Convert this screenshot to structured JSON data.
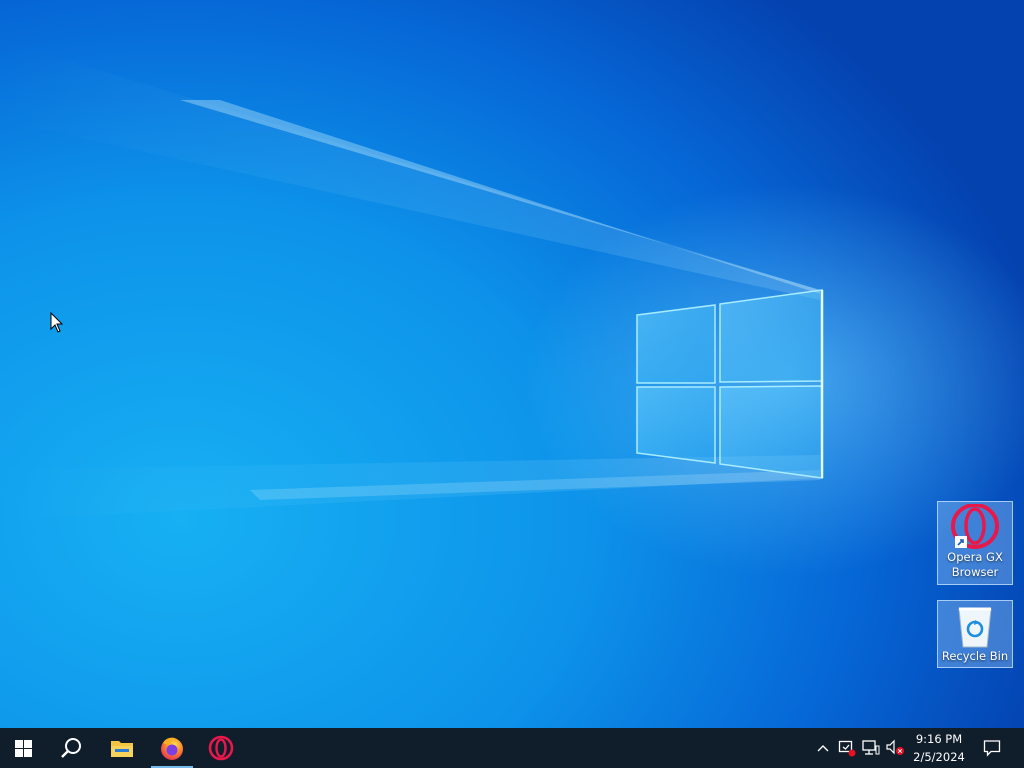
{
  "desktop": {
    "wallpaper": "windows-10-hero",
    "colors": {
      "background": "#0a6fdc",
      "taskbar": "#101d2b",
      "accent": "#76b9ed",
      "opera_red": "#e8194a",
      "folder_yellow": "#f4c542"
    },
    "icons": [
      {
        "label": "Opera GX Browser",
        "icon": "opera-gx-icon",
        "shortcut": true
      },
      {
        "label": "Recycle Bin",
        "icon": "recycle-bin-icon",
        "shortcut": false
      }
    ]
  },
  "taskbar": {
    "pinned": [
      {
        "name": "start",
        "icon": "windows-start-icon"
      },
      {
        "name": "search",
        "icon": "search-icon"
      },
      {
        "name": "file-explorer",
        "icon": "folder-icon"
      },
      {
        "name": "firefox",
        "icon": "firefox-icon",
        "active": true
      },
      {
        "name": "opera",
        "icon": "opera-icon"
      }
    ],
    "tray": {
      "icons": [
        "chevron-up-icon",
        "security-alert-icon",
        "network-icon",
        "volume-muted-icon"
      ],
      "time": "9:16 PM",
      "date": "2/5/2024",
      "notification": "action-center-icon"
    }
  }
}
